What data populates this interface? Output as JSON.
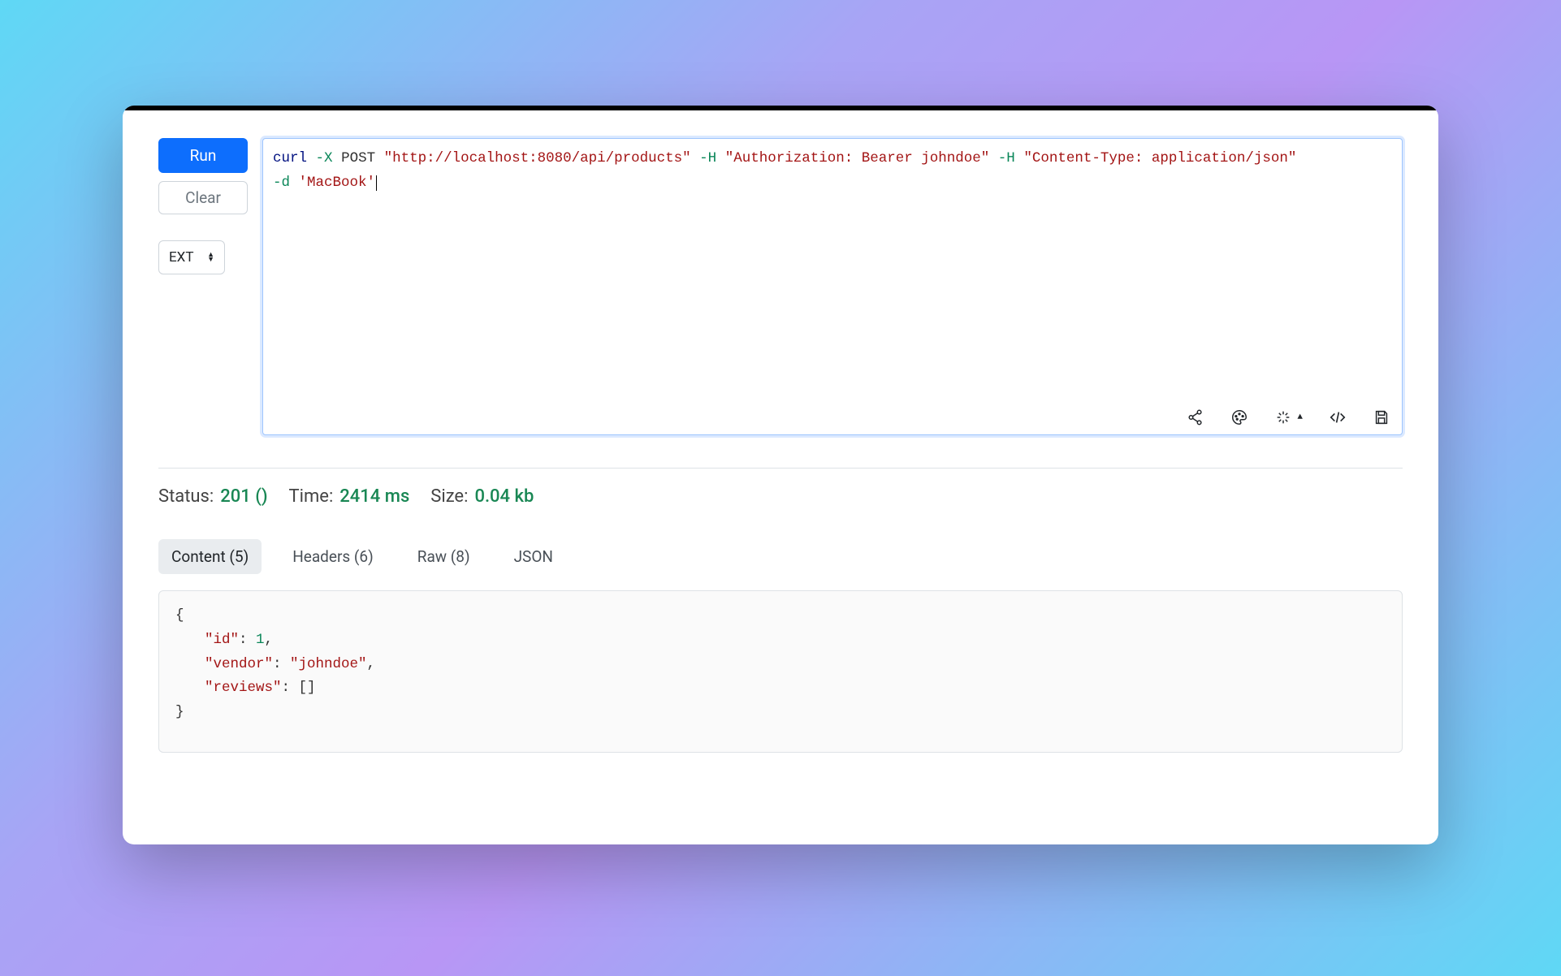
{
  "controls": {
    "run_label": "Run",
    "clear_label": "Clear",
    "ext_label": "EXT"
  },
  "editor": {
    "tokens": {
      "curl": "curl",
      "flag_x": "-X",
      "method": "POST",
      "url": "\"http://localhost:8080/api/products\"",
      "flag_h1": "-H",
      "header1": "\"Authorization: Bearer johndoe\"",
      "flag_h2": "-H",
      "header2": "\"Content-Type: application/json\"",
      "flag_d": "-d",
      "body": "'MacBook'"
    }
  },
  "toolbar_icons": {
    "share": "share-icon",
    "palette": "palette-icon",
    "magic": "magic-wand-icon",
    "code": "code-icon",
    "save": "save-icon"
  },
  "status": {
    "status_label": "Status:",
    "status_value": "201 ()",
    "time_label": "Time:",
    "time_value": "2414 ms",
    "size_label": "Size:",
    "size_value": "0.04 kb"
  },
  "tabs": {
    "content": "Content (5)",
    "headers": "Headers (6)",
    "raw": "Raw (8)",
    "json": "JSON"
  },
  "response": {
    "open": "{",
    "id_key": "\"id\"",
    "id_val": "1",
    "vendor_key": "\"vendor\"",
    "vendor_val": "\"johndoe\"",
    "reviews_key": "\"reviews\"",
    "reviews_val": "[]",
    "close": "}"
  }
}
